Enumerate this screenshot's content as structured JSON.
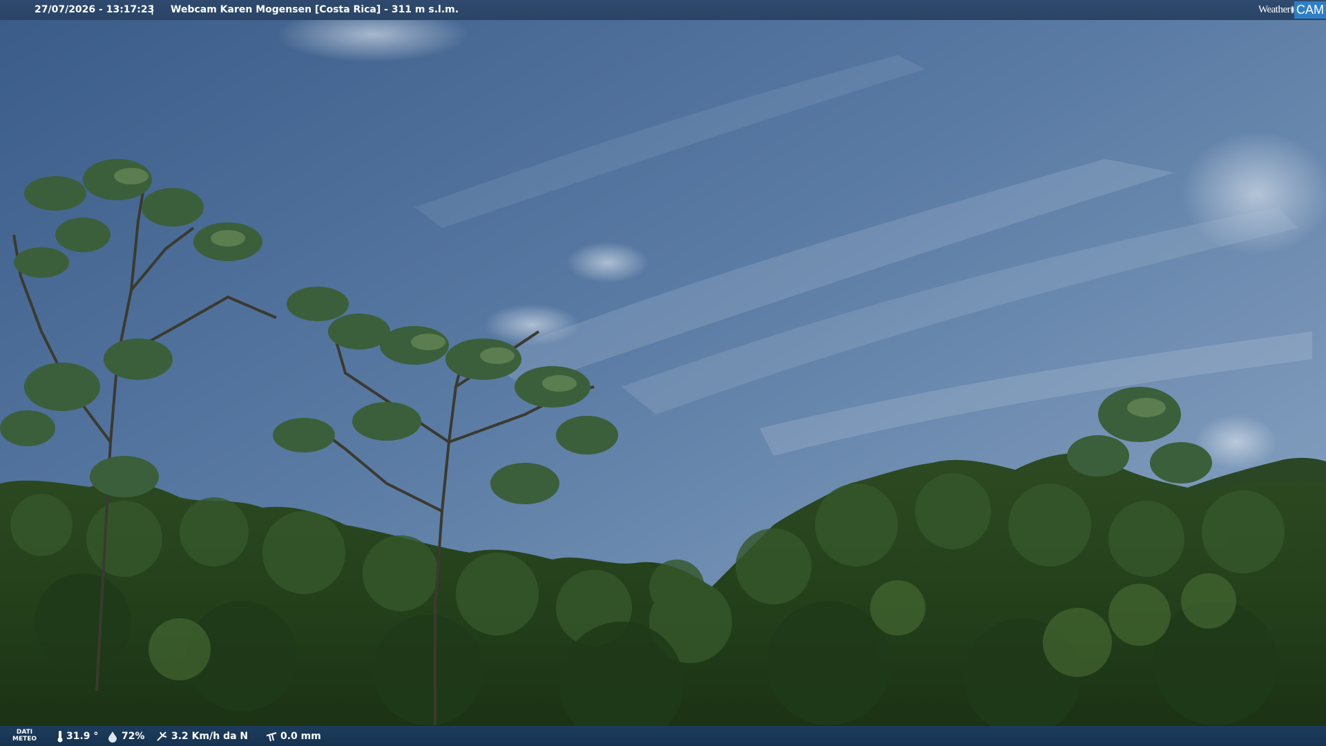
{
  "header": {
    "datetime": "27/07/2026 - 13:17:23",
    "separator": "|",
    "title": "Webcam Karen Mogensen [Costa Rica] - 311 m s.l.m."
  },
  "logo": {
    "weather": "Weather",
    "cam": "CAM"
  },
  "footer": {
    "label_line1": "DATI",
    "label_line2": "METEO",
    "temperature": "31.9 °",
    "humidity": "72%",
    "wind": "3.2 Km/h da N",
    "rain": "0.0 mm"
  },
  "icons": {
    "temperature": "thermometer-icon",
    "humidity": "humidity-icon",
    "wind": "wind-icon",
    "rain": "rain-gauge-icon"
  }
}
